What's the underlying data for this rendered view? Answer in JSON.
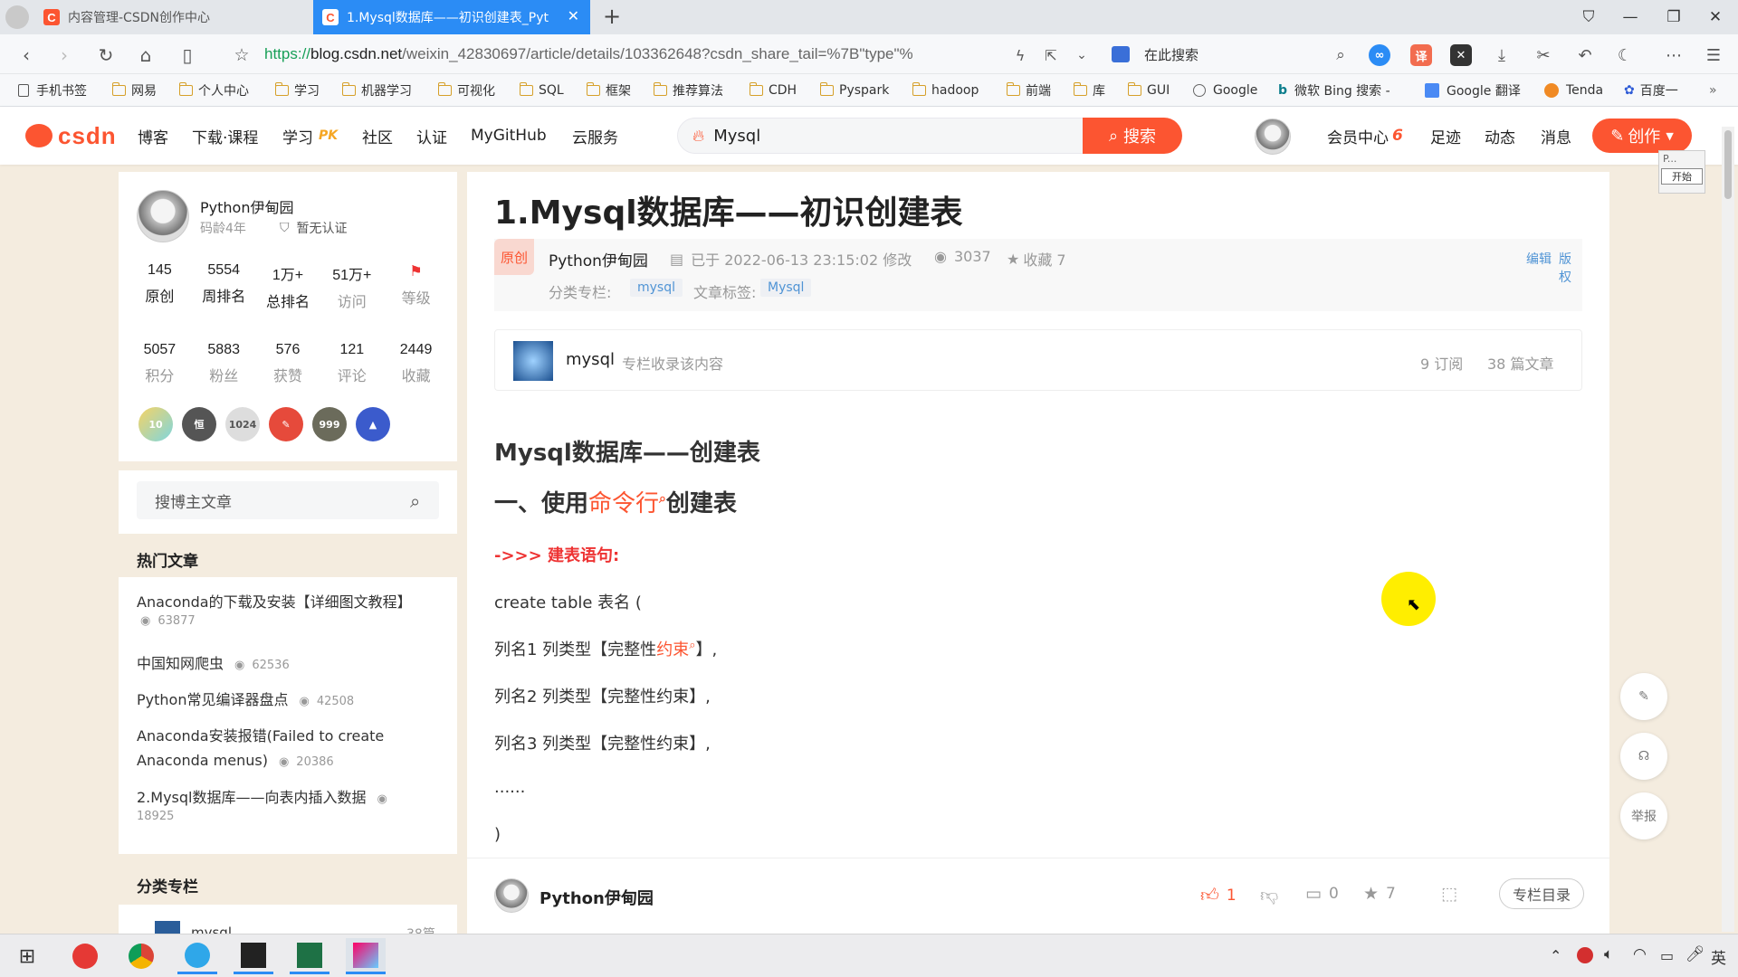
{
  "browser": {
    "tabs": [
      {
        "label": "内容管理-CSDN创作中心",
        "active": false
      },
      {
        "label": "1.Mysql数据库——初识创建表_Pyt",
        "active": true
      }
    ],
    "new_tab": "+",
    "url_prefix": "https://",
    "url_domain": "blog.csdn.net",
    "url_rest": "/weixin_42830697/article/details/103362648?csdn_share_tail=%7B\"type\"%",
    "search_placeholder": "在此搜索",
    "translate_ext": "译"
  },
  "bookmarks": [
    "手机书签",
    "网易",
    "个人中心",
    "学习",
    "机器学习",
    "可视化",
    "SQL",
    "框架",
    "推荐算法",
    "CDH",
    "Pyspark",
    "hadoop",
    "前端",
    "库",
    "GUI",
    "Google",
    "微软 Bing 搜索 -",
    "Google 翻译",
    "Tenda",
    "百度一"
  ],
  "csdn_header": {
    "logo": "CSDN",
    "nav": [
      "博客",
      "下载·课程",
      "学习",
      "社区",
      "认证",
      "MyGitHub",
      "云服务"
    ],
    "nav_pk": "PK",
    "search_value": "Mysql",
    "search_button": "搜索",
    "vip": "会员中心",
    "vip_badge": "6",
    "right_links": [
      "足迹",
      "动态",
      "消息"
    ],
    "create_button": "创作",
    "tooltip_top": "P...",
    "tooltip_btn": "开始"
  },
  "profile": {
    "name": "Python伊甸园",
    "age": "码龄4年",
    "cert": "暂无认证",
    "stats_row1": [
      {
        "n": "145",
        "l": "原创"
      },
      {
        "n": "5554",
        "l": "周排名"
      },
      {
        "n": "1万+",
        "l": "总排名"
      },
      {
        "n": "51万+",
        "l": "访问"
      },
      {
        "n": "",
        "l": "等级"
      }
    ],
    "stats_row2": [
      {
        "n": "5057",
        "l": "积分"
      },
      {
        "n": "5883",
        "l": "粉丝"
      },
      {
        "n": "576",
        "l": "获赞"
      },
      {
        "n": "121",
        "l": "评论"
      },
      {
        "n": "2449",
        "l": "收藏"
      }
    ],
    "badges": [
      "10",
      "恒",
      "1024",
      "✎",
      "999",
      "▲"
    ]
  },
  "sidebar_search": {
    "placeholder": "搜博主文章"
  },
  "hot": {
    "title": "热门文章",
    "items": [
      {
        "title": "Anaconda的下载及安装【详细图文教程】",
        "views": "63877"
      },
      {
        "title": "中国知网爬虫",
        "views": "62536"
      },
      {
        "title": "Python常见编译器盘点",
        "views": "42508"
      },
      {
        "title": "Anaconda安装报错(Failed to create Anaconda menus)",
        "views": "20386"
      },
      {
        "title": "2.Mysql数据库——向表内插入数据",
        "views": "18925"
      }
    ]
  },
  "category": {
    "title": "分类专栏",
    "item": "mysql",
    "count": "38篇"
  },
  "article": {
    "title": "1.Mysql数据库——初识创建表",
    "original": "原创",
    "author": "Python伊甸园",
    "modified": "已于 2022-06-13 23:15:02 修改",
    "views": "3037",
    "favorites": "收藏 7",
    "edit": "编辑",
    "copyright": "版权",
    "category_label": "分类专栏:",
    "category_tag": "mysql",
    "tags_label": "文章标签:",
    "tag": "Mysql",
    "column_name": "mysql",
    "column_desc": "专栏收录该内容",
    "column_subs": "9 订阅",
    "column_articles": "38 篇文章",
    "h2": "Mysql数据库——创建表",
    "h3_pre": "一、使用",
    "h3_link": "命令行",
    "h3_post": "创建表",
    "syntax_label": "->>> 建表语句:",
    "code_line": "create table  表名 (",
    "col1_pre": "列名1  列类型【完整性",
    "col1_link": "约束",
    "col1_post": "】,",
    "col2": "列名2  列类型【完整性约束】,",
    "col3": "列名3  列类型【完整性约束】,",
    "ellipsis": "......",
    "close": ")"
  },
  "footer_bar": {
    "author": "Python伊甸园",
    "likes": "1",
    "comments": "0",
    "favs": "7",
    "toc": "专栏目录"
  },
  "floating": {
    "report": "举报"
  },
  "taskbar": {
    "ime": "英"
  },
  "colors": {
    "brand": "#fc5531",
    "tab_active": "#2b8cf5",
    "cursor_highlight": "#ffee00"
  }
}
